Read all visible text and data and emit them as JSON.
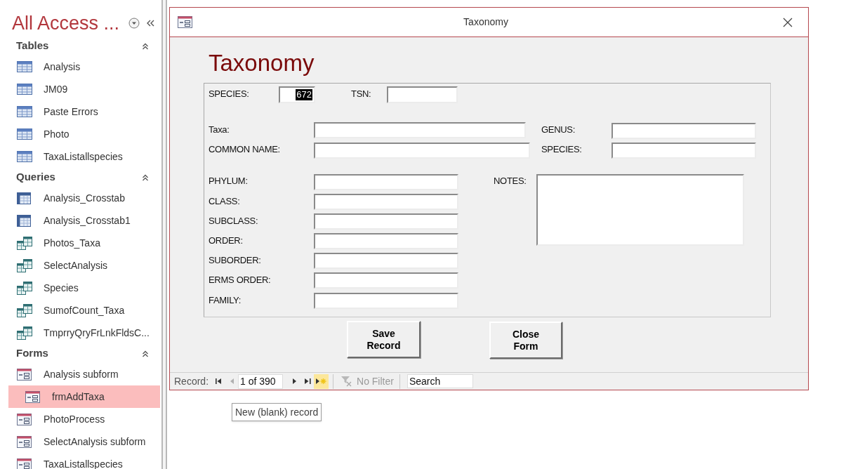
{
  "navigation_pane": {
    "title": "All Access ...",
    "groups": [
      {
        "name": "Tables",
        "expanded": true,
        "items": [
          {
            "label": "Analysis",
            "kind": "table",
            "selected": false
          },
          {
            "label": "JM09",
            "kind": "table",
            "selected": false
          },
          {
            "label": "Paste Errors",
            "kind": "table",
            "selected": false
          },
          {
            "label": "Photo",
            "kind": "table",
            "selected": false
          },
          {
            "label": "TaxaListallspecies",
            "kind": "table",
            "selected": false
          }
        ]
      },
      {
        "name": "Queries",
        "expanded": true,
        "items": [
          {
            "label": "Analysis_Crosstab",
            "kind": "crosstab",
            "selected": false
          },
          {
            "label": "Analysis_Crosstab1",
            "kind": "crosstab",
            "selected": false
          },
          {
            "label": "Photos_Taxa",
            "kind": "query",
            "selected": false
          },
          {
            "label": "SelectAnalysis",
            "kind": "query",
            "selected": false
          },
          {
            "label": "Species",
            "kind": "query",
            "selected": false
          },
          {
            "label": "SumofCount_Taxa",
            "kind": "query",
            "selected": false
          },
          {
            "label": "TmprryQryFrLnkFldsC...",
            "kind": "query",
            "selected": false
          }
        ]
      },
      {
        "name": "Forms",
        "expanded": true,
        "items": [
          {
            "label": "Analysis subform",
            "kind": "form",
            "selected": false
          },
          {
            "label": "frmAddTaxa",
            "kind": "form",
            "selected": true
          },
          {
            "label": "PhotoProcess",
            "kind": "form",
            "selected": false
          },
          {
            "label": "SelectAnalysis subform",
            "kind": "form",
            "selected": false
          },
          {
            "label": "TaxaListallspecies",
            "kind": "form",
            "selected": false
          }
        ]
      }
    ]
  },
  "window": {
    "title": "Taxonomy"
  },
  "form": {
    "heading": "Taxonomy",
    "fields": [
      {
        "label": "SPECIES:",
        "kind": "textbox",
        "value": "672",
        "text_selected": true
      },
      {
        "label": "TSN:",
        "kind": "textbox"
      },
      {
        "label": "Taxa:",
        "kind": "textbox"
      },
      {
        "label": "GENUS:",
        "kind": "textbox"
      },
      {
        "label": "COMMON NAME:",
        "kind": "textbox"
      },
      {
        "label": "SPECIES:",
        "kind": "textbox"
      },
      {
        "label": "PHYLUM:",
        "kind": "textbox"
      },
      {
        "label": "NOTES:",
        "kind": "memo"
      },
      {
        "label": "CLASS:",
        "kind": "textbox"
      },
      {
        "label": "SUBCLASS:",
        "kind": "textbox"
      },
      {
        "label": "ORDER:",
        "kind": "textbox"
      },
      {
        "label": "SUBORDER:",
        "kind": "textbox"
      },
      {
        "label": "ERMS ORDER:",
        "kind": "textbox"
      },
      {
        "label": "FAMILY:",
        "kind": "textbox"
      }
    ],
    "buttons": [
      "Save Record",
      "Close Form"
    ]
  },
  "record_navigator": {
    "label": "Record:",
    "position": "1 of 390",
    "new_record_hovered": true,
    "filter": "No Filter",
    "filter_active": false,
    "search_placeholder": "Search"
  },
  "tooltip": "New (blank) record"
}
